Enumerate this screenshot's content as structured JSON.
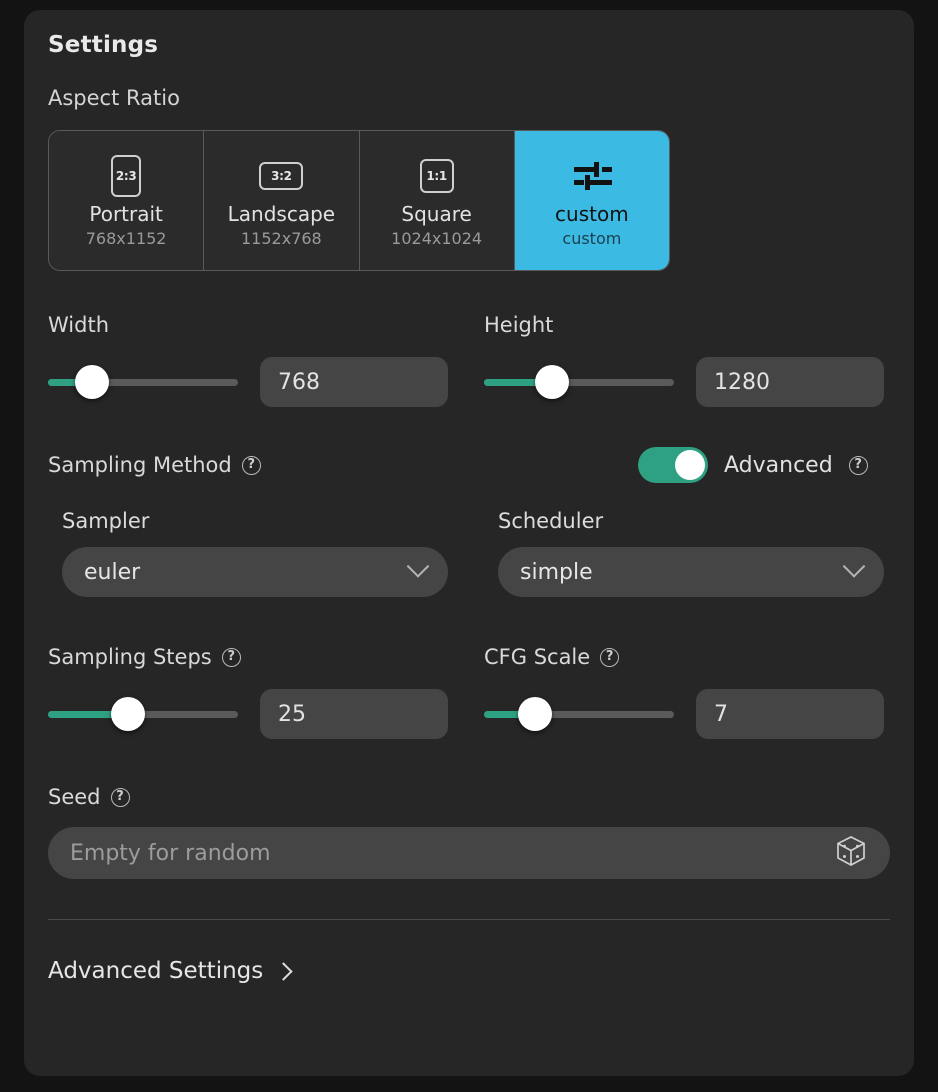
{
  "panel": {
    "title": "Settings"
  },
  "aspect_ratio": {
    "label": "Aspect Ratio",
    "selected": "custom",
    "accent_color": "#3bbbe4",
    "options": [
      {
        "name": "Portrait",
        "dims": "768x1152",
        "ratio": "2:3",
        "icon": "portrait-ratio-icon"
      },
      {
        "name": "Landscape",
        "dims": "1152x768",
        "ratio": "3:2",
        "icon": "landscape-ratio-icon"
      },
      {
        "name": "Square",
        "dims": "1024x1024",
        "ratio": "1:1",
        "icon": "square-ratio-icon"
      },
      {
        "name": "custom",
        "dims": "custom",
        "ratio": "",
        "icon": "sliders-icon"
      }
    ]
  },
  "width": {
    "label": "Width",
    "value": "768",
    "slider_percent": 23
  },
  "height": {
    "label": "Height",
    "value": "1280",
    "slider_percent": 36
  },
  "sampling_method": {
    "label": "Sampling Method",
    "help_icon": "help-circle-icon",
    "advanced": {
      "label": "Advanced",
      "enabled": true,
      "help_icon": "help-circle-icon",
      "toggle_color": "#2fa183"
    },
    "sampler": {
      "label": "Sampler",
      "value": "euler",
      "chevron": "chevron-down-icon"
    },
    "scheduler": {
      "label": "Scheduler",
      "value": "simple",
      "chevron": "chevron-down-icon"
    }
  },
  "sampling_steps": {
    "label": "Sampling Steps",
    "value": "25",
    "slider_percent": 42,
    "help_icon": "help-circle-icon"
  },
  "cfg_scale": {
    "label": "CFG Scale",
    "value": "7",
    "slider_percent": 27,
    "help_icon": "help-circle-icon"
  },
  "seed": {
    "label": "Seed",
    "value": "",
    "placeholder": "Empty for random",
    "help_icon": "help-circle-icon",
    "randomize_icon": "dice-icon"
  },
  "footer": {
    "advanced_settings_label": "Advanced Settings",
    "chevron": "chevron-right-icon"
  },
  "colors": {
    "panel_bg": "#262626",
    "page_bg": "#131313",
    "slider_fill": "#2fa183",
    "accent": "#3bbbe4",
    "input_bg": "#454545"
  }
}
